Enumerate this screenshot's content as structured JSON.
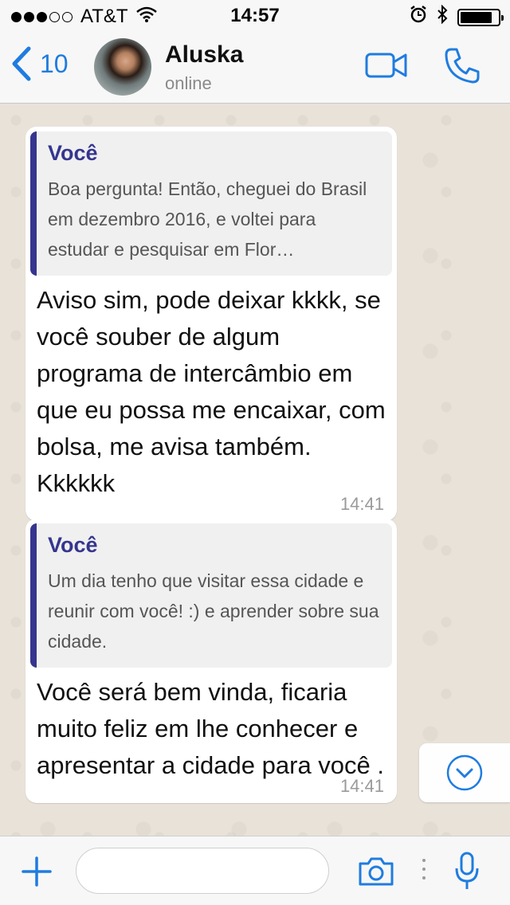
{
  "status_bar": {
    "carrier": "AT&T",
    "time": "14:57",
    "signal_dots_filled": 3,
    "signal_dots_total": 5,
    "battery_level": 0.85
  },
  "header": {
    "back_count": "10",
    "contact_name": "Aluska",
    "contact_status": "online"
  },
  "messages": [
    {
      "quote_author": "Você",
      "quote_text": "Boa pergunta! Então, cheguei do Brasil em dezembro 2016, e voltei para estudar e pesquisar em Flor…",
      "text": "Aviso sim, pode deixar kkkk, se você souber de algum programa de intercâmbio em que eu possa me encaixar, com bolsa, me avisa também. Kkkkkk",
      "time": "14:41"
    },
    {
      "quote_author": "Você",
      "quote_text": "Um dia tenho que visitar essa cidade e reunir com você! :) e aprender sobre sua cidade.",
      "text": "Você será bem vinda, ficaria muito feliz em lhe conhecer e apresentar a cidade para você .",
      "time": "14:41"
    }
  ],
  "input": {
    "placeholder": ""
  },
  "colors": {
    "accent_blue": "#1f7ce0",
    "quote_author": "#35358f",
    "chat_background": "#e8e2d9"
  },
  "icons": {
    "back": "chevron-left-icon",
    "video": "video-camera-icon",
    "call": "phone-icon",
    "scroll": "chevron-down-circle-icon",
    "attach": "plus-icon",
    "camera": "camera-icon",
    "mic": "microphone-icon"
  }
}
